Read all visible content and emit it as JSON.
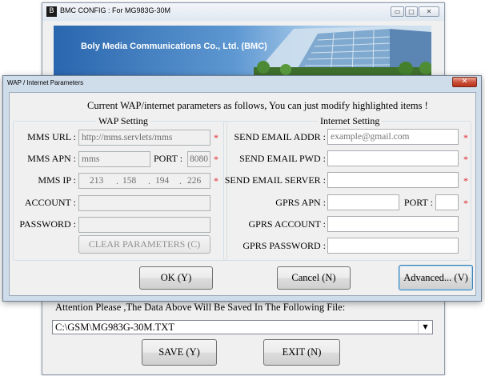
{
  "main_window": {
    "title": "BMC CONFIG : For MG983G-30M",
    "app_icon": "bmc-app-icon",
    "controls": {
      "minimize": "▭",
      "maximize": "□",
      "close": "✕"
    },
    "banner_text": "Boly Media Communications Co., Ltd. (BMC)",
    "attention_text": "Attention Please ,The Data Above Will Be Saved In The Following  File:",
    "file_path": "C:\\GSM\\MG983G-30M.TXT",
    "save_label": "SAVE (Y)",
    "exit_label": "EXIT (N)"
  },
  "dialog": {
    "title": "WAP / Internet Parameters",
    "close_glyph": "✕",
    "header": "Current WAP/internet parameters as follows, You can just modify highlighted items !",
    "required_mark": "*",
    "wap": {
      "legend": "WAP Setting",
      "mms_url_label": "MMS URL :",
      "mms_url_value": "http://mms.servlets/mms",
      "mms_apn_label": "MMS APN :",
      "mms_apn_value": "mms",
      "port_label": "PORT :",
      "port_value": "8080",
      "mms_ip_label": "MMS IP :",
      "mms_ip": [
        "213",
        "158",
        "194",
        "226"
      ],
      "ip_dot": ".",
      "account_label": "ACCOUNT :",
      "account_value": "",
      "password_label": "PASSWORD :",
      "password_value": "",
      "clear_label": "CLEAR PARAMETERS (C)"
    },
    "internet": {
      "legend": "Internet Setting",
      "send_email_addr_label": "SEND EMAIL ADDR :",
      "send_email_addr_placeholder": "example@gmail.com",
      "send_email_pwd_label": "SEND EMAIL PWD :",
      "send_email_pwd_value": "",
      "send_email_server_label": "SEND EMAIL SERVER :",
      "send_email_server_value": "",
      "gprs_apn_label": "GPRS APN :",
      "gprs_apn_value": "",
      "gprs_port_label": "PORT :",
      "gprs_port_value": "",
      "gprs_account_label": "GPRS ACCOUNT :",
      "gprs_account_value": "",
      "gprs_password_label": "GPRS PASSWORD :",
      "gprs_password_value": ""
    },
    "ok_label": "OK (Y)",
    "cancel_label": "Cancel (N)",
    "advanced_label": "Advanced... (V)"
  },
  "colors": {
    "required": "#e0242a",
    "dialog_frame": "#cfdcea",
    "banner_blue": "#2a66ae",
    "close_red": "#c94c35"
  }
}
